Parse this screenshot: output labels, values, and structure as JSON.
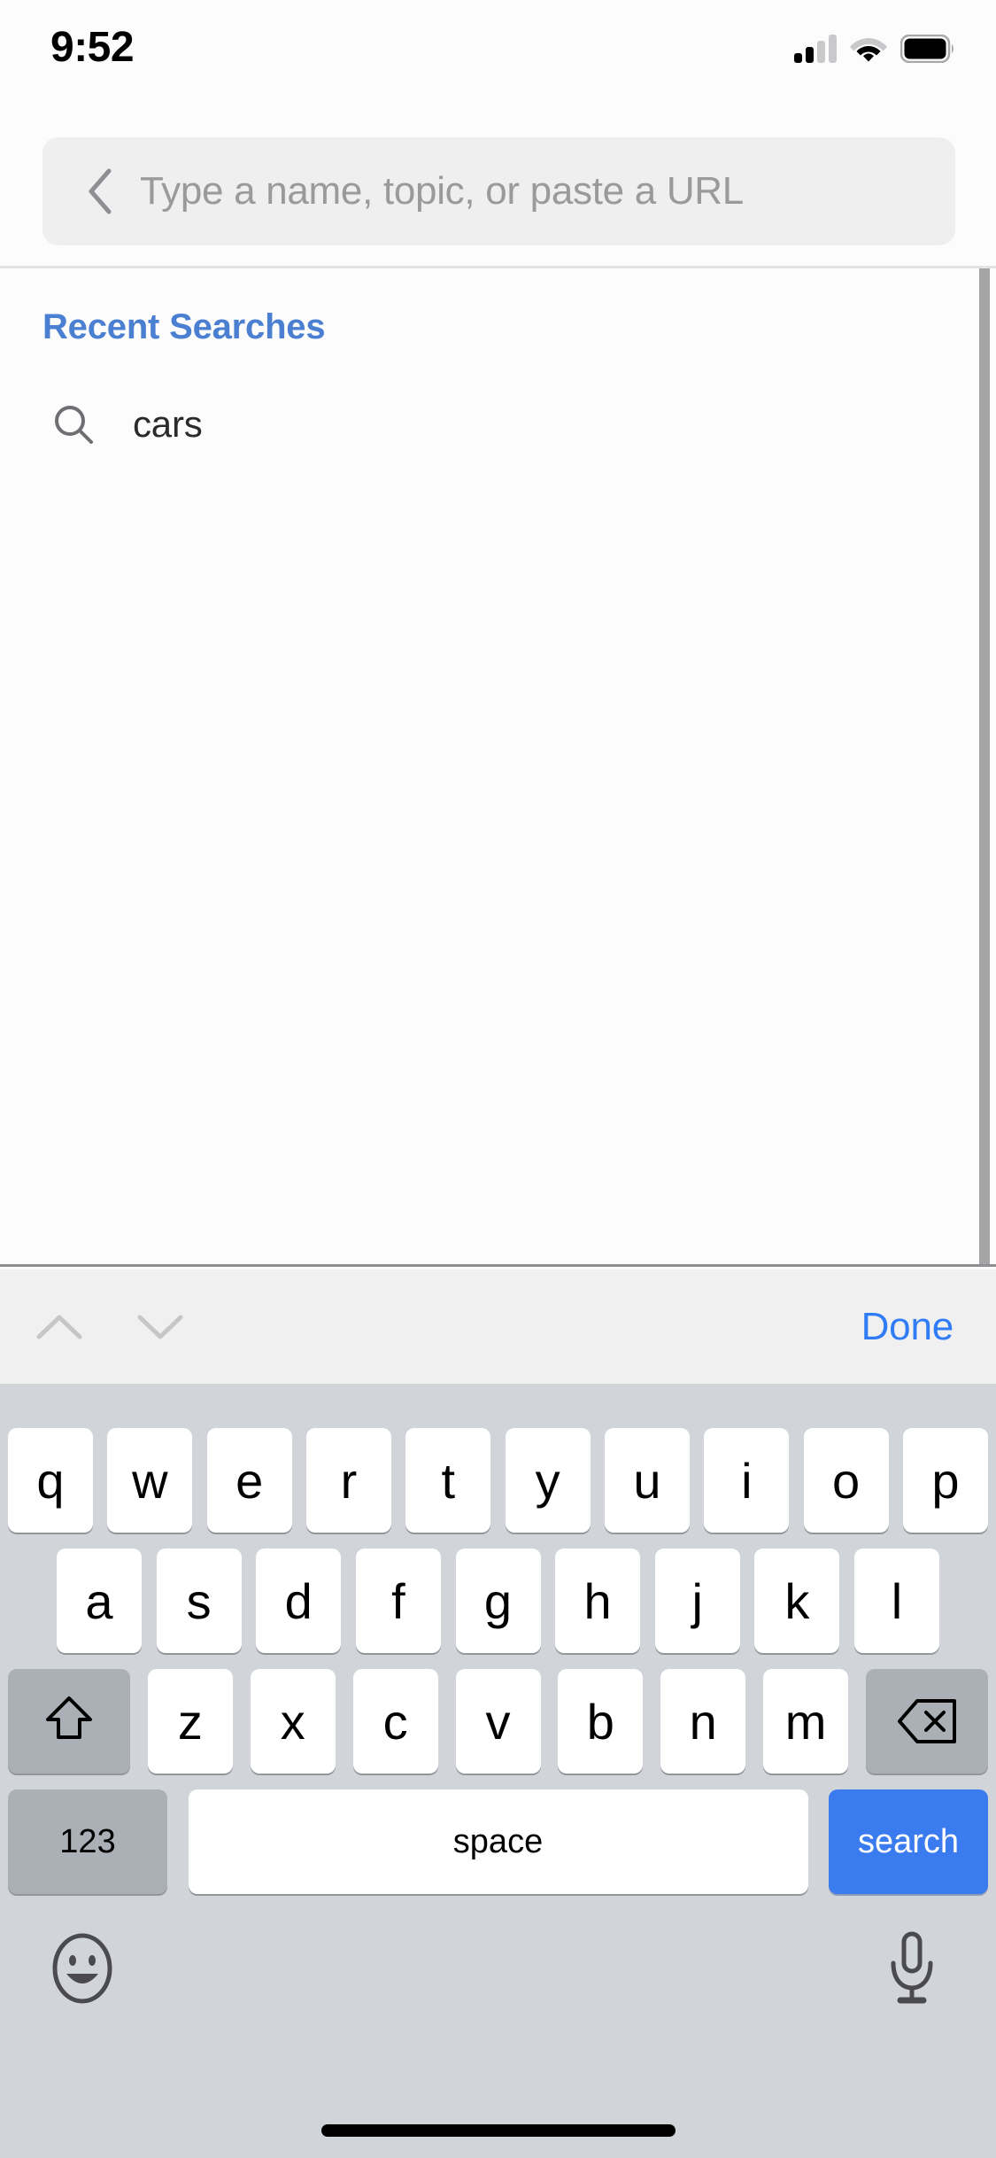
{
  "status_bar": {
    "time": "9:52",
    "cellular_icon": "cellular-signal-icon",
    "cellular_bars_filled": 2,
    "cellular_bars_total": 4,
    "wifi_icon": "wifi-icon",
    "battery_icon": "battery-full-icon"
  },
  "search_header": {
    "back_icon": "chevron-left-icon",
    "placeholder": "Type a name, topic, or paste a URL",
    "value": ""
  },
  "content": {
    "section_title": "Recent Searches",
    "recent_searches": [
      {
        "label": "cars",
        "icon": "magnifier-icon"
      }
    ],
    "scrollbar_icon": "vertical-scrollbar"
  },
  "keyboard_toolbar": {
    "prev_icon": "chevron-up-icon",
    "next_icon": "chevron-down-icon",
    "done_label": "Done",
    "accent_color": "#2f7cf6"
  },
  "keyboard": {
    "row1": [
      "q",
      "w",
      "e",
      "r",
      "t",
      "y",
      "u",
      "i",
      "o",
      "p"
    ],
    "row2": [
      "a",
      "s",
      "d",
      "f",
      "g",
      "h",
      "j",
      "k",
      "l"
    ],
    "row3_letters": [
      "z",
      "x",
      "c",
      "v",
      "b",
      "n",
      "m"
    ],
    "shift_icon": "shift-arrow-icon",
    "backspace_icon": "backspace-delete-icon",
    "numbers_label": "123",
    "space_label": "space",
    "return_label": "search",
    "emoji_icon": "emoji-smiley-icon",
    "dictation_icon": "microphone-icon",
    "return_key_color": "#3a7bf0",
    "key_color": "#ffffff",
    "modifier_color": "#abafb6",
    "background_color": "#d1d5da"
  },
  "home_indicator": "home-indicator-bar"
}
